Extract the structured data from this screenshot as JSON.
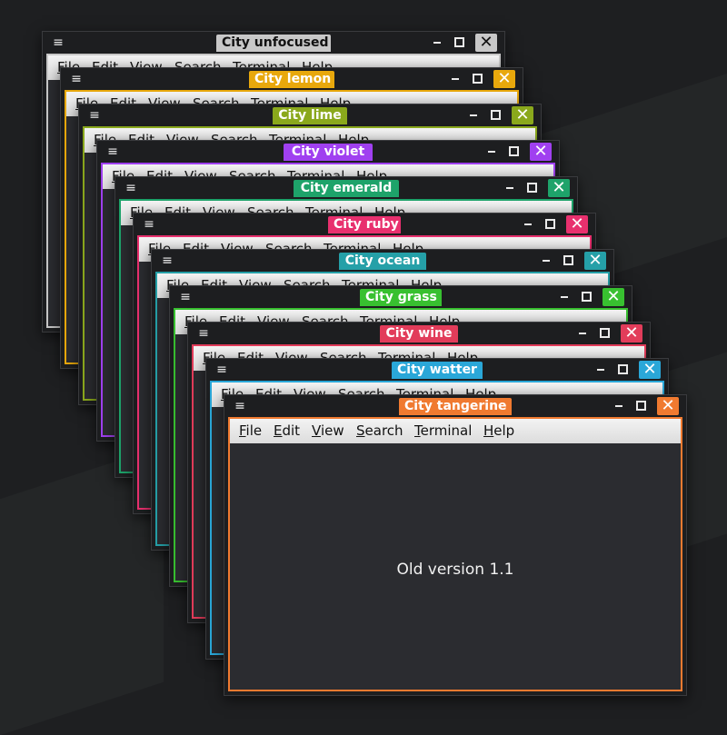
{
  "menu_items": [
    "File",
    "Edit",
    "View",
    "Search",
    "Terminal",
    "Help"
  ],
  "windows": [
    {
      "title": "City unfocused",
      "accent": "#c8c8c8",
      "title_text": "#111111"
    },
    {
      "title": "City lemon",
      "accent": "#e8a80c",
      "title_text": "#ffffff"
    },
    {
      "title": "City lime",
      "accent": "#8aa81c",
      "title_text": "#ffffff"
    },
    {
      "title": "City violet",
      "accent": "#a040f0",
      "title_text": "#ffffff"
    },
    {
      "title": "City emerald",
      "accent": "#1ea36a",
      "title_text": "#ffffff"
    },
    {
      "title": "City ruby",
      "accent": "#e8306e",
      "title_text": "#ffffff"
    },
    {
      "title": "City ocean",
      "accent": "#25a0a8",
      "title_text": "#ffffff"
    },
    {
      "title": "City grass",
      "accent": "#38c030",
      "title_text": "#ffffff"
    },
    {
      "title": "City wine",
      "accent": "#e23c5a",
      "title_text": "#ffffff"
    },
    {
      "title": "City watter",
      "accent": "#2aa7d8",
      "title_text": "#ffffff"
    },
    {
      "title": "City tangerine",
      "accent": "#f07a30",
      "title_text": "#ffffff"
    }
  ],
  "content_text": "Old version 1.1",
  "icons": {
    "menu": "hamburger-icon",
    "minimize": "minimize-icon",
    "maximize": "maximize-icon",
    "close": "close-icon"
  }
}
